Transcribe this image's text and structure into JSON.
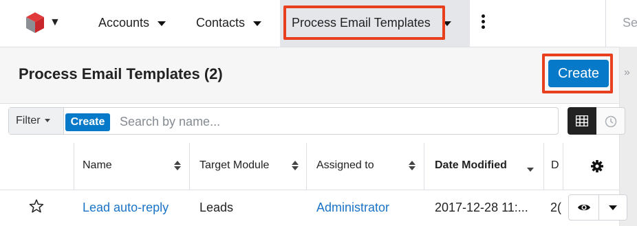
{
  "nav": {
    "tabs": [
      {
        "label": "Accounts"
      },
      {
        "label": "Contacts"
      },
      {
        "label": "Process Email Templates"
      }
    ],
    "search_fragment": "Se"
  },
  "header": {
    "title": "Process Email Templates (2)",
    "create_label": "Create"
  },
  "filter": {
    "filter_label": "Filter",
    "create_label": "Create",
    "search_placeholder": "Search by name..."
  },
  "table": {
    "columns": [
      "Name",
      "Target Module",
      "Assigned to",
      "Date Modified",
      "D"
    ],
    "rows": [
      {
        "name": "Lead auto-reply",
        "target_module": "Leads",
        "assigned_to": "Administrator",
        "date_modified": "2017-12-28 11:...",
        "d_fragment": "2("
      }
    ]
  },
  "colors": {
    "accent": "#0679c8",
    "highlight": "#e8401f",
    "link": "#1a73c7"
  },
  "icons": [
    "sugar-cube-logo-icon",
    "kebab-menu-icon",
    "sidebar-toggle-icon",
    "list-view-icon",
    "clock-icon",
    "sort-icon",
    "gear-icon",
    "star-icon",
    "eye-icon",
    "caret-down-icon"
  ]
}
